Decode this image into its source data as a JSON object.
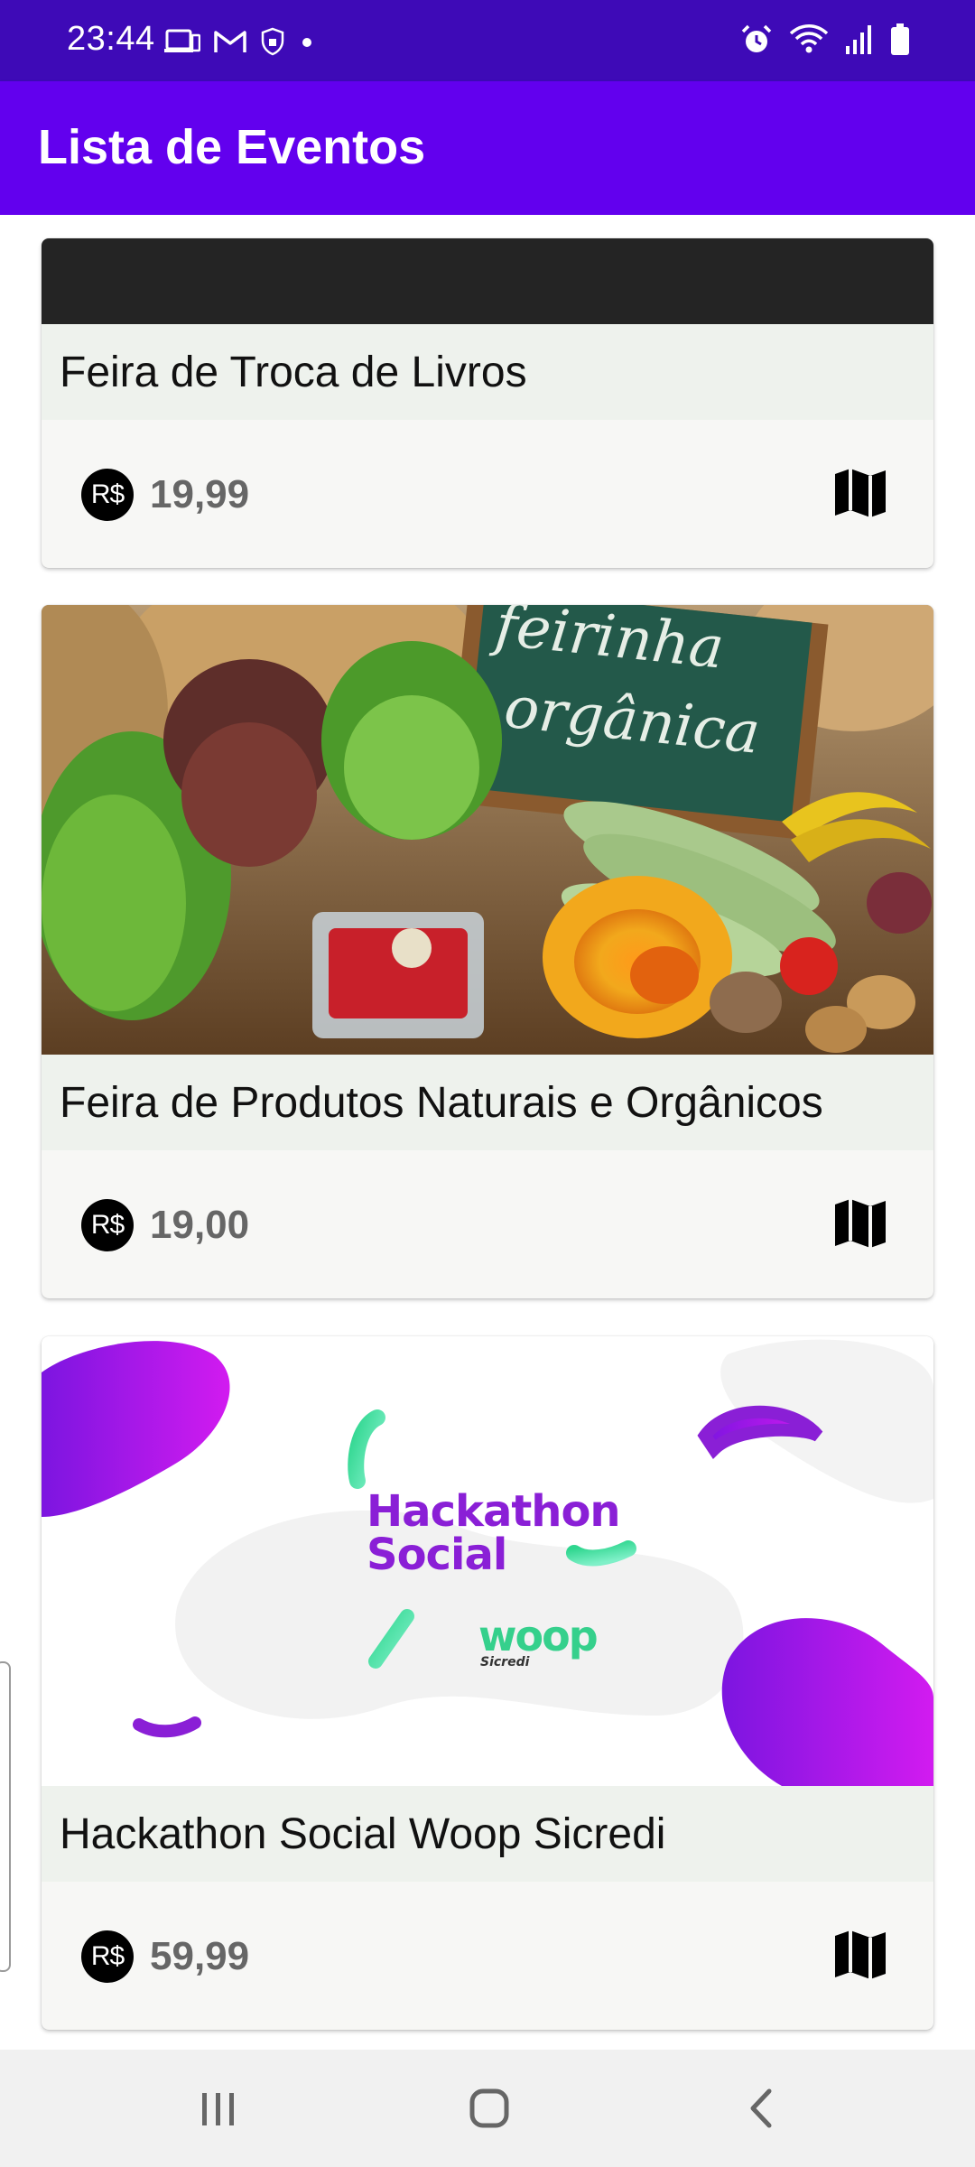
{
  "status_bar": {
    "time": "23:44",
    "left_icons": [
      "screen-icon",
      "gmail-icon",
      "shield-icon",
      "notification-dot-icon"
    ],
    "right_icons": [
      "alarm-icon",
      "wifi-icon",
      "signal-icon",
      "battery-icon"
    ]
  },
  "app_bar": {
    "title": "Lista de Eventos"
  },
  "events": [
    {
      "title": "Feira de Troca de Livros",
      "currency_symbol": "R$",
      "price": "19,99",
      "map_icon": "map-icon"
    },
    {
      "title": "Feira de Produtos Naturais e Orgânicos",
      "currency_symbol": "R$",
      "price": "19,00",
      "map_icon": "map-icon",
      "image_text": "feirinha orgânica"
    },
    {
      "title": "Hackathon Social Woop Sicredi",
      "currency_symbol": "R$",
      "price": "59,99",
      "map_icon": "map-icon",
      "logo_text": {
        "line1": "Hackathon",
        "line2": "Social",
        "brand": "woop",
        "brand_sub": "Sicredi"
      }
    }
  ],
  "nav_bar": {
    "buttons": [
      "recents-icon",
      "home-icon",
      "back-icon"
    ]
  },
  "colors": {
    "status_bar": "#3E0AB7",
    "app_bar": "#6200EE",
    "card_bg": "#F7F7F5",
    "title_band": "#EEF2ED",
    "price_text": "#666666",
    "hackathon_purple": "#8A1FD6",
    "hackathon_green": "#3EE0A8"
  }
}
